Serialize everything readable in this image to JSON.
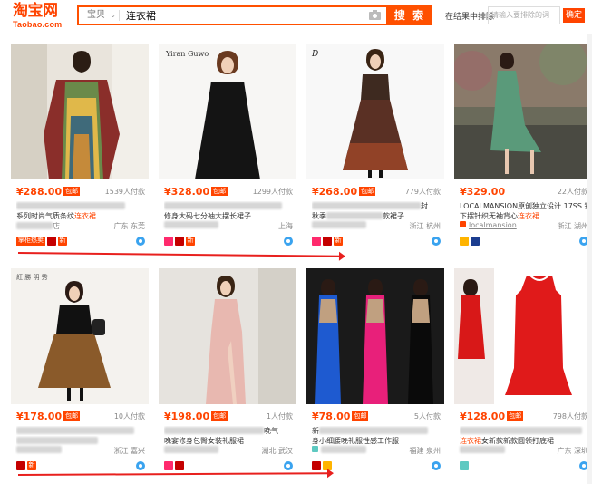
{
  "header": {
    "logo_main": "淘宝网",
    "logo_sub": "Taobao.com",
    "search_type": "宝贝",
    "search_value": "连衣裙",
    "search_button": "搜 索",
    "filter_label": "在结果中排除",
    "filter_placeholder": "请输入要排除的词",
    "filter_button": "确定"
  },
  "products": [
    {
      "price": "¥288.00",
      "badge": "包邮",
      "sold": "1539人付款",
      "line1": "",
      "line2_pre": "系列时尚气质条纹",
      "line2_hl": "连衣裙",
      "shop": "店",
      "location": "广东 东莞",
      "tags": [
        "掌柜热卖",
        "tmall",
        "xin"
      ]
    },
    {
      "price": "¥328.00",
      "badge": "包邮",
      "sold": "1299人付款",
      "line1": "",
      "line2_pre": "修身大码七分袖大摆长裙子",
      "line2_hl": "",
      "shop": "",
      "location": "上海",
      "tags": [
        "tag",
        "tmall",
        "xin"
      ]
    },
    {
      "price": "¥268.00",
      "badge": "包邮",
      "sold": "779人付款",
      "line1": "封",
      "line2_pre": "秋季",
      "line2_hl": "",
      "line2_post": "款裙子",
      "shop": "",
      "location": "浙江 杭州",
      "tags": [
        "tag",
        "tmall",
        "xin"
      ]
    },
    {
      "price": "¥329.00",
      "badge": "",
      "sold": "22人付款",
      "line1": "LOCALMANSION原创独立设计 17SS 镂空",
      "line2_pre": "下摆针织无袖背心",
      "line2_hl": "连衣裙",
      "shop": "localmansion",
      "location": "浙江 湖州",
      "tags": [
        "gold",
        "navy"
      ]
    },
    {
      "price": "¥178.00",
      "badge": "包邮",
      "sold": "10人付款",
      "line1": "",
      "line2_pre": "",
      "line2_hl": "",
      "shop": "",
      "location": "浙江 嘉兴",
      "tags": [
        "tmall",
        "xin"
      ]
    },
    {
      "price": "¥198.00",
      "badge": "包邮",
      "sold": "1人付款",
      "line1": "晚气",
      "line2_pre": "晚宴修身包臀女装礼服裙",
      "line2_hl": "",
      "shop": "",
      "location": "湖北 武汉",
      "tags": [
        "tag",
        "tmall"
      ]
    },
    {
      "price": "¥78.00",
      "badge": "包邮",
      "sold": "5人付款",
      "line1": "新",
      "line2_pre": "身小细腰晚礼服性感工作服",
      "line2_hl": "",
      "shop": "",
      "location": "福建 泉州",
      "tags": [
        "tmall",
        "gold"
      ]
    },
    {
      "price": "¥128.00",
      "badge": "包邮",
      "sold": "798人付款",
      "line1": "",
      "line2_pre": "",
      "line2_hl": "连衣裙",
      "line2_post": "女新款新款圆领打底裙",
      "shop": "",
      "location": "广东 深圳",
      "tags": [
        "teal"
      ]
    }
  ],
  "colors": {
    "accent": "#ff4400",
    "search_border": "#ff5000",
    "annotation_arrow": "#e8201e"
  }
}
